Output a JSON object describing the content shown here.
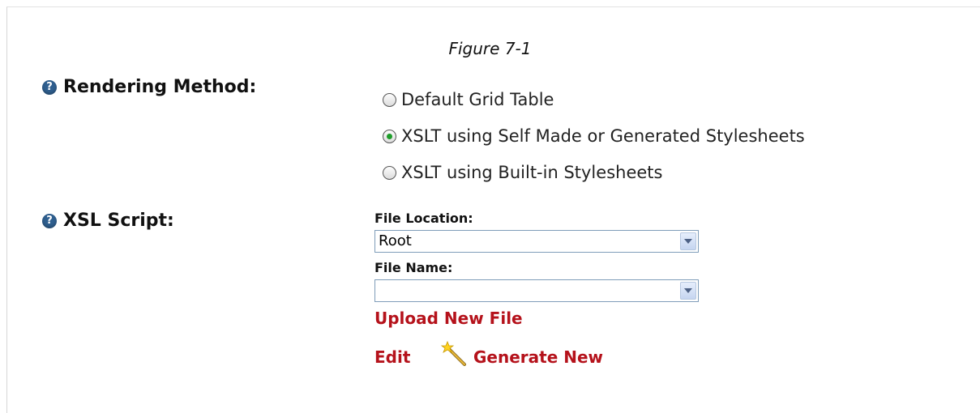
{
  "caption": "Figure 7-1",
  "rendering_method": {
    "label": "Rendering Method:",
    "options": [
      {
        "label": "Default Grid Table",
        "checked": false
      },
      {
        "label": "XSLT using Self Made or Generated Stylesheets",
        "checked": true
      },
      {
        "label": "XSLT using Built-in Stylesheets",
        "checked": false
      }
    ]
  },
  "xsl_script": {
    "label": "XSL Script:",
    "file_location_label": "File Location:",
    "file_location_value": "Root",
    "file_name_label": "File Name:",
    "file_name_value": "",
    "upload_link": "Upload New File",
    "edit_link": "Edit",
    "generate_link": "Generate New"
  },
  "icons": {
    "help": "question-circle-icon",
    "generate": "magic-wand-icon",
    "dropdown": "chevron-down-icon"
  },
  "colors": {
    "link": "#b5121b",
    "help_icon": "#2f5f8f",
    "radio_checked": "#1e9d2a"
  }
}
